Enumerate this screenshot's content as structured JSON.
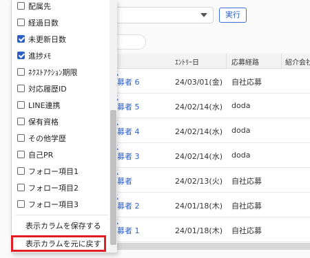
{
  "toolbar": {
    "run_label": "実行"
  },
  "table": {
    "headers": [
      "ｴﾝﾄﾘｰ日",
      "応募経路",
      "紹介会社"
    ],
    "rows": [
      {
        "name": "募者 6",
        "date": "24/03/01(金)",
        "route": "自社応募"
      },
      {
        "name": "募者 5",
        "date": "24/02/14(水)",
        "route": "doda"
      },
      {
        "name": "募者 4",
        "date": "24/02/14(水)",
        "route": "doda"
      },
      {
        "name": "募者 3",
        "date": "24/02/14(水)",
        "route": "doda"
      },
      {
        "name": "募者",
        "date": "24/02/13(火)",
        "route": "自社応募"
      },
      {
        "name": "募者 2",
        "date": "24/01/18(木)",
        "route": "自社応募"
      },
      {
        "name": "募者 1",
        "date": "24/01/18(木)",
        "route": "自社応募"
      }
    ]
  },
  "column_menu": {
    "items": [
      {
        "label": "配属先",
        "checked": false
      },
      {
        "label": "経過日数",
        "checked": false
      },
      {
        "label": "未更新日数",
        "checked": true
      },
      {
        "label": "進捗ﾒﾓ",
        "checked": true
      },
      {
        "label": "ﾈｸｽﾄｱｸｼｮﾝ期限",
        "checked": false
      },
      {
        "label": "対応履歴ID",
        "checked": false
      },
      {
        "label": "LINE連携",
        "checked": false
      },
      {
        "label": "保有資格",
        "checked": false
      },
      {
        "label": "その他学歴",
        "checked": false
      },
      {
        "label": "自己PR",
        "checked": false
      },
      {
        "label": "フォロー項目1",
        "checked": false
      },
      {
        "label": "フォロー項目2",
        "checked": false
      },
      {
        "label": "フォロー項目3",
        "checked": false
      }
    ],
    "save_label": "表示カラムを保存する",
    "reset_label": "表示カラムを元に戻す"
  },
  "colors": {
    "accent": "#2a5fc6",
    "highlight": "#e31b23"
  }
}
